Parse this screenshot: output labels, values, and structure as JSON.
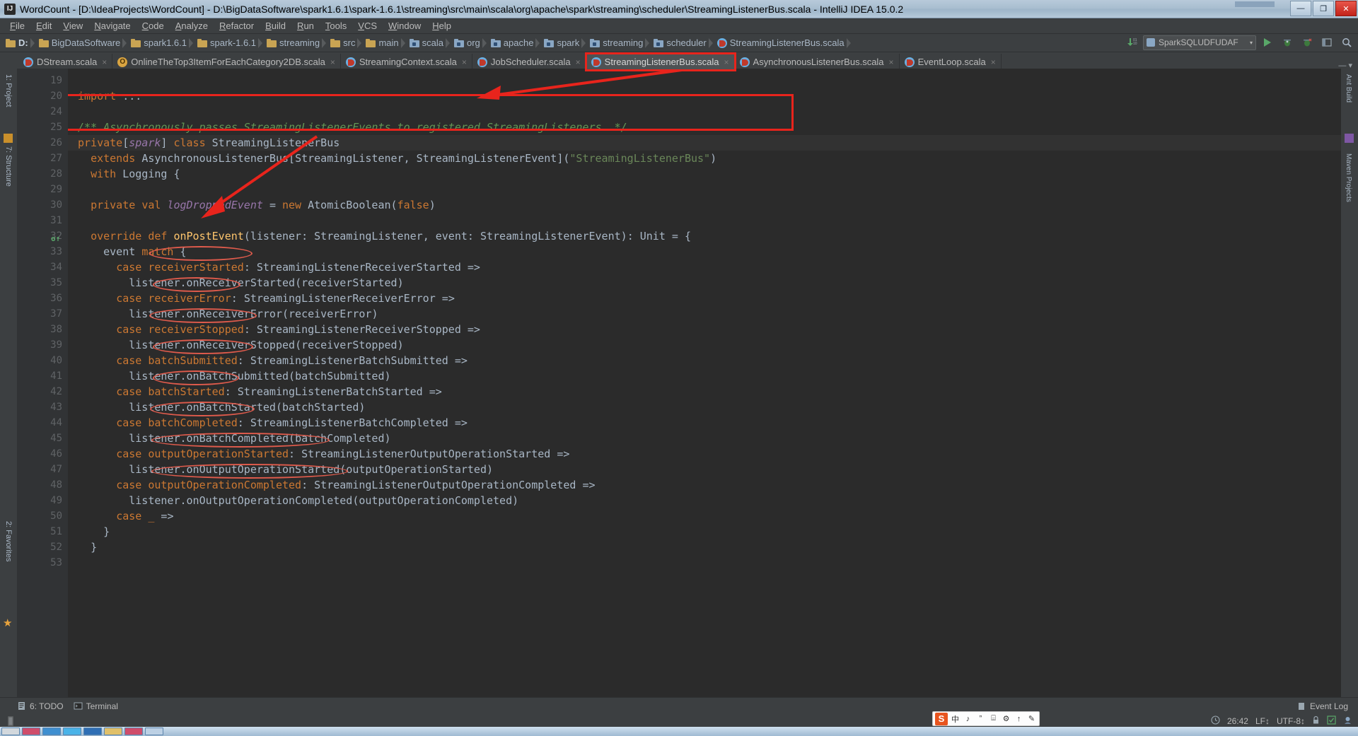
{
  "window": {
    "title": "WordCount - [D:\\IdeaProjects\\WordCount] - D:\\BigDataSoftware\\spark1.6.1\\spark-1.6.1\\streaming\\src\\main\\scala\\org\\apache\\spark\\streaming\\scheduler\\StreamingListenerBus.scala - IntelliJ IDEA 15.0.2",
    "app_icon": "IJ",
    "minimize_label": "—",
    "maximize_label": "❐",
    "close_label": "✕"
  },
  "menu": {
    "items": [
      {
        "label": "File"
      },
      {
        "label": "Edit"
      },
      {
        "label": "View"
      },
      {
        "label": "Navigate"
      },
      {
        "label": "Code"
      },
      {
        "label": "Analyze"
      },
      {
        "label": "Refactor"
      },
      {
        "label": "Build"
      },
      {
        "label": "Run"
      },
      {
        "label": "Tools"
      },
      {
        "label": "VCS"
      },
      {
        "label": "Window"
      },
      {
        "label": "Help"
      }
    ]
  },
  "breadcrumb": {
    "items": [
      {
        "label": "D:",
        "icon": "folder-icon",
        "bold": true
      },
      {
        "label": "BigDataSoftware",
        "icon": "folder-icon"
      },
      {
        "label": "spark1.6.1",
        "icon": "folder-icon"
      },
      {
        "label": "spark-1.6.1",
        "icon": "folder-icon"
      },
      {
        "label": "streaming",
        "icon": "folder-icon"
      },
      {
        "label": "src",
        "icon": "folder-icon"
      },
      {
        "label": "main",
        "icon": "folder-icon"
      },
      {
        "label": "scala",
        "icon": "source-folder-icon"
      },
      {
        "label": "org",
        "icon": "source-folder-icon"
      },
      {
        "label": "apache",
        "icon": "source-folder-icon"
      },
      {
        "label": "spark",
        "icon": "source-folder-icon"
      },
      {
        "label": "streaming",
        "icon": "source-folder-icon"
      },
      {
        "label": "scheduler",
        "icon": "source-folder-icon"
      },
      {
        "label": "StreamingListenerBus.scala",
        "icon": "scala-file-icon"
      }
    ]
  },
  "toolbar": {
    "update_project_icon": "update-arrow-icon",
    "run_config_label": "SparkSQLUDFUDAF",
    "run_config_caret": "▾",
    "run_label": "run-button",
    "debug_label": "debug-button",
    "coverage_label": "coverage-button",
    "layout_label": "layout-button",
    "search_label": "search-button"
  },
  "editor_tabs": [
    {
      "label": "DStream.scala",
      "icon": "scala-file-icon",
      "selected": false,
      "highlighted": false,
      "close": "×"
    },
    {
      "label": "OnlineTheTop3ItemForEachCategory2DB.scala",
      "icon": "scala-object-icon",
      "selected": false,
      "highlighted": false,
      "close": "×"
    },
    {
      "label": "StreamingContext.scala",
      "icon": "scala-file-icon",
      "selected": false,
      "highlighted": false,
      "close": "×"
    },
    {
      "label": "JobScheduler.scala",
      "icon": "scala-file-icon",
      "selected": false,
      "highlighted": false,
      "close": "×"
    },
    {
      "label": "StreamingListenerBus.scala",
      "icon": "scala-file-icon",
      "selected": true,
      "highlighted": true,
      "close": "×"
    },
    {
      "label": "AsynchronousListenerBus.scala",
      "icon": "scala-file-icon",
      "selected": false,
      "highlighted": false,
      "close": "×"
    },
    {
      "label": "EventLoop.scala",
      "icon": "scala-file-icon",
      "selected": false,
      "highlighted": false,
      "close": "×"
    }
  ],
  "tabs_overflow_icon": "▾",
  "left_rail": {
    "items": [
      {
        "label": "1: Project"
      },
      {
        "label": "7: Structure"
      },
      {
        "label": "2: Favorites"
      }
    ],
    "star_icon": "star-icon"
  },
  "right_rail": {
    "items": [
      {
        "label": "Ant Build"
      },
      {
        "label": "Maven Projects"
      }
    ]
  },
  "code": {
    "line_numbers": [
      "19",
      "20",
      "24",
      "25",
      "26",
      "27",
      "28",
      "29",
      "30",
      "31",
      "32",
      "33",
      "34",
      "35",
      "36",
      "37",
      "38",
      "39",
      "40",
      "41",
      "42",
      "43",
      "44",
      "45",
      "46",
      "47",
      "48",
      "49",
      "50",
      "51",
      "52",
      "53"
    ],
    "lines": [
      {
        "n": "19",
        "text": ""
      },
      {
        "n": "20",
        "text": "import ..."
      },
      {
        "n": "24",
        "text": ""
      },
      {
        "n": "25",
        "text": "/** Asynchronously passes StreamingListenerEvents to registered StreamingListeners. */"
      },
      {
        "n": "26",
        "text": "private[spark] class StreamingListenerBus"
      },
      {
        "n": "27",
        "text": "  extends AsynchronousListenerBus[StreamingListener, StreamingListenerEvent](\"StreamingListenerBus\")"
      },
      {
        "n": "28",
        "text": "  with Logging {"
      },
      {
        "n": "29",
        "text": ""
      },
      {
        "n": "30",
        "text": "  private val logDroppedEvent = new AtomicBoolean(false)"
      },
      {
        "n": "31",
        "text": ""
      },
      {
        "n": "32",
        "text": "  override def onPostEvent(listener: StreamingListener, event: StreamingListenerEvent): Unit = {"
      },
      {
        "n": "33",
        "text": "    event match {"
      },
      {
        "n": "34",
        "text": "      case receiverStarted: StreamingListenerReceiverStarted =>"
      },
      {
        "n": "35",
        "text": "        listener.onReceiverStarted(receiverStarted)"
      },
      {
        "n": "36",
        "text": "      case receiverError: StreamingListenerReceiverError =>"
      },
      {
        "n": "37",
        "text": "        listener.onReceiverError(receiverError)"
      },
      {
        "n": "38",
        "text": "      case receiverStopped: StreamingListenerReceiverStopped =>"
      },
      {
        "n": "39",
        "text": "        listener.onReceiverStopped(receiverStopped)"
      },
      {
        "n": "40",
        "text": "      case batchSubmitted: StreamingListenerBatchSubmitted =>"
      },
      {
        "n": "41",
        "text": "        listener.onBatchSubmitted(batchSubmitted)"
      },
      {
        "n": "42",
        "text": "      case batchStarted: StreamingListenerBatchStarted =>"
      },
      {
        "n": "43",
        "text": "        listener.onBatchStarted(batchStarted)"
      },
      {
        "n": "44",
        "text": "      case batchCompleted: StreamingListenerBatchCompleted =>"
      },
      {
        "n": "45",
        "text": "        listener.onBatchCompleted(batchCompleted)"
      },
      {
        "n": "46",
        "text": "      case outputOperationStarted: StreamingListenerOutputOperationStarted =>"
      },
      {
        "n": "47",
        "text": "        listener.onOutputOperationStarted(outputOperationStarted)"
      },
      {
        "n": "48",
        "text": "      case outputOperationCompleted: StreamingListenerOutputOperationCompleted =>"
      },
      {
        "n": "49",
        "text": "        listener.onOutputOperationCompleted(outputOperationCompleted)"
      },
      {
        "n": "50",
        "text": "      case _ =>"
      },
      {
        "n": "51",
        "text": "    }"
      },
      {
        "n": "52",
        "text": "  }"
      },
      {
        "n": "53",
        "text": ""
      }
    ]
  },
  "annotations": {
    "tab_highlight_label": "StreamingListenerBus.scala",
    "class_box_label": "private[spark] class StreamingListenerBus",
    "arrow_1": "arrow-from-tab-to-class-declaration",
    "arrow_2": "arrow-from-class-to-onPostEvent",
    "circled_tokens": [
      "receiverStarted",
      "receiverError",
      "receiverStopped",
      "batchSubmitted",
      "batchStarted",
      "batchCompleted",
      "outputOperationStarted",
      "outputOperationCompleted"
    ],
    "accent_color": "#e8241c",
    "ellipse_color": "#e05b4c"
  },
  "bottom_bar": {
    "todo_label": "6: TODO",
    "todo_icon": "todo-icon",
    "terminal_label": "Terminal",
    "terminal_icon": "terminal-icon",
    "event_log_label": "Event Log",
    "event_log_icon": "event-log-icon"
  },
  "status_bar": {
    "caret_position": "26:42",
    "line_separator": "LF↕",
    "encoding": "UTF-8↕",
    "lock_icon": "lock-icon",
    "memory_icon": "memory-indicator",
    "inspection_icon": "inspection-icon",
    "hector_icon": "hector-icon",
    "clock_icon": "clock-icon"
  },
  "ime": {
    "brand": "S",
    "buttons": [
      "中",
      "♪",
      "ˮ",
      "⌸",
      "⚙",
      "↑",
      "✎"
    ]
  }
}
